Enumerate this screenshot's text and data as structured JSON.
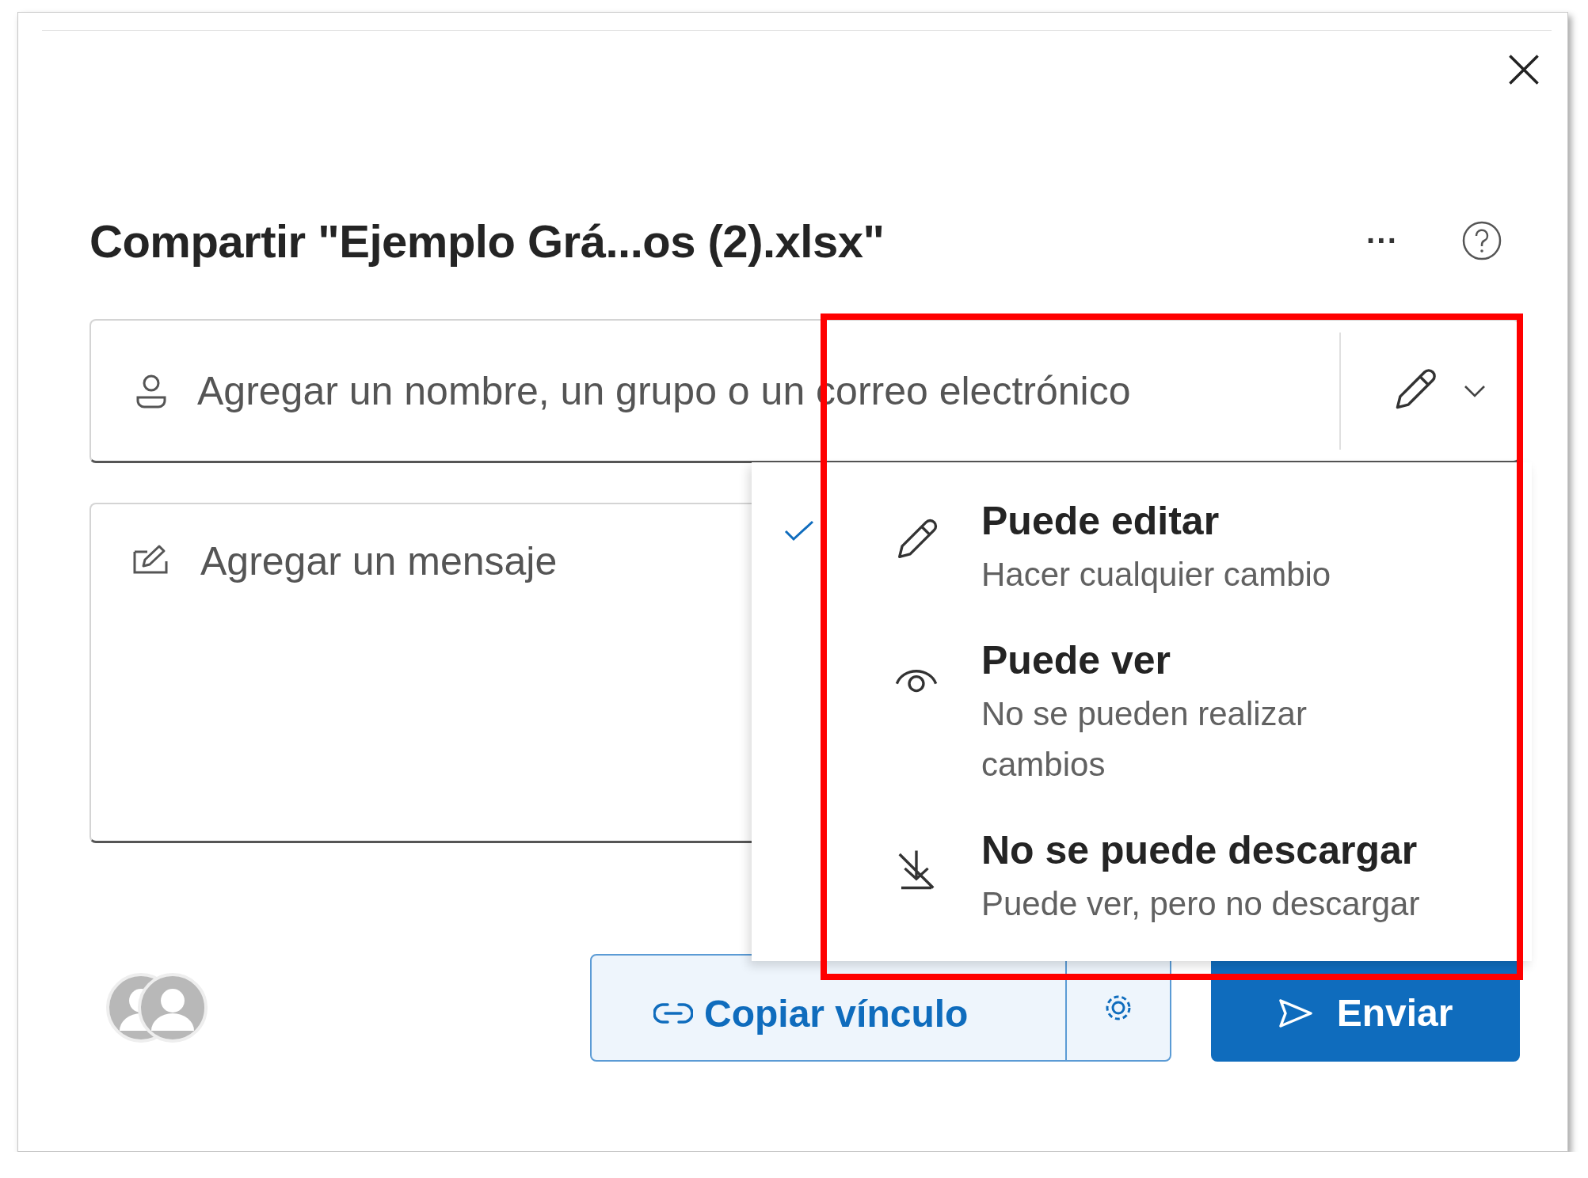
{
  "dialog": {
    "title": "Compartir \"Ejemplo Grá...os (2).xlsx\"",
    "more_label": "···"
  },
  "recipient_field": {
    "placeholder": "Agregar un nombre, un grupo o un correo electrónico"
  },
  "message_field": {
    "placeholder": "Agregar un mensaje"
  },
  "permission_menu": {
    "expanded": true,
    "items": [
      {
        "kind": "edit",
        "title": "Puede editar",
        "subtitle": "Hacer cualquier cambio",
        "selected": true
      },
      {
        "kind": "view",
        "title": "Puede ver",
        "subtitle": "No se pueden realizar cambios",
        "selected": false
      },
      {
        "kind": "nodownload",
        "title": "No se puede descargar",
        "subtitle": "Puede ver, pero no descargar",
        "selected": false
      }
    ]
  },
  "buttons": {
    "copy_link": "Copiar vínculo",
    "send": "Enviar"
  }
}
